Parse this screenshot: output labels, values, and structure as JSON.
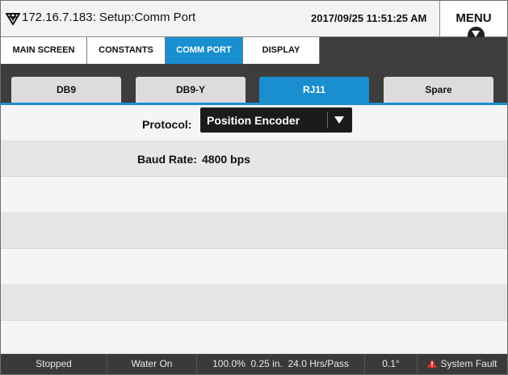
{
  "header": {
    "title": "172.16.7.183: Setup:Comm Port",
    "datetime": "2017/09/25 11:51:25 AM",
    "menu_label": "MENU",
    "logo_icon": "logo-icon",
    "menu_icon": "chevron-down-icon"
  },
  "top_tabs": [
    "MAIN SCREEN",
    "CONSTANTS",
    "COMM PORT",
    "DISPLAY"
  ],
  "top_tabs_active": "COMM PORT",
  "sub_tabs": [
    "DB9",
    "DB9-Y",
    "RJ11",
    "Spare"
  ],
  "sub_tabs_active": "RJ11",
  "settings": {
    "protocol_label": "Protocol:",
    "protocol_value": "Position Encoder",
    "baud_label": "Baud Rate:",
    "baud_value": "4800 bps"
  },
  "status": {
    "state": "Stopped",
    "water": "Water On",
    "metrics": "100.0%  0.25 in.  24.0 Hrs/Pass",
    "angle": "0.1°",
    "fault": "System Fault",
    "fault_icon": "warning-icon"
  },
  "colors": {
    "accent": "#1a8fd0",
    "dark_bar": "#3d3d3d",
    "status_bar": "#3a3a3a",
    "warning": "#d32f2f"
  }
}
